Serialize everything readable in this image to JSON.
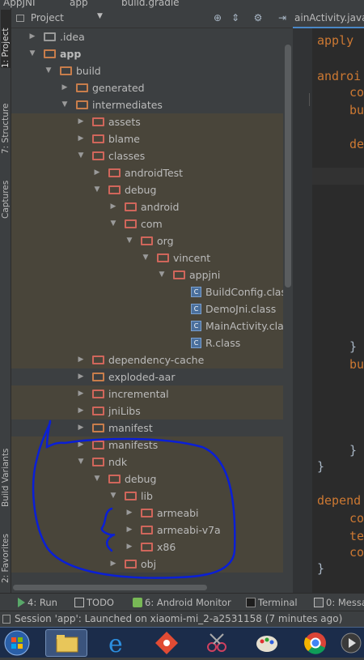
{
  "titlebar": {
    "crumbs": [
      "AppJNI",
      "app",
      "build.gradle"
    ]
  },
  "left_strip": {
    "tabs": [
      "1: Project",
      "7: Structure",
      "Captures",
      "Build Variants",
      "2: Favorites"
    ]
  },
  "project_panel": {
    "view_selector": "Project",
    "header_icons": [
      "locate-icon",
      "collapse-icon",
      "gear-icon",
      "hide-icon"
    ]
  },
  "tree": [
    {
      "label": ".idea",
      "level": 1,
      "state": "collapsed",
      "icon": "folder-grey",
      "excluded": false
    },
    {
      "label": "app",
      "level": 1,
      "state": "expanded",
      "icon": "folder-module",
      "excluded": false
    },
    {
      "label": "build",
      "level": 2,
      "state": "expanded",
      "icon": "folder",
      "excluded": false
    },
    {
      "label": "generated",
      "level": 3,
      "state": "collapsed",
      "icon": "folder",
      "excluded": false
    },
    {
      "label": "intermediates",
      "level": 3,
      "state": "expanded",
      "icon": "folder",
      "excluded": false
    },
    {
      "label": "assets",
      "level": 4,
      "state": "collapsed",
      "icon": "folder",
      "excluded": true
    },
    {
      "label": "blame",
      "level": 4,
      "state": "collapsed",
      "icon": "folder",
      "excluded": true
    },
    {
      "label": "classes",
      "level": 4,
      "state": "expanded",
      "icon": "folder",
      "excluded": true
    },
    {
      "label": "androidTest",
      "level": 5,
      "state": "collapsed",
      "icon": "folder",
      "excluded": true
    },
    {
      "label": "debug",
      "level": 5,
      "state": "expanded",
      "icon": "folder",
      "excluded": true
    },
    {
      "label": "android",
      "level": 6,
      "state": "collapsed",
      "icon": "folder",
      "excluded": true
    },
    {
      "label": "com",
      "level": 6,
      "state": "expanded",
      "icon": "folder",
      "excluded": true
    },
    {
      "label": "org",
      "level": 7,
      "state": "expanded",
      "icon": "folder",
      "excluded": true
    },
    {
      "label": "vincent",
      "level": 8,
      "state": "expanded",
      "icon": "folder",
      "excluded": true
    },
    {
      "label": "appjni",
      "level": 9,
      "state": "expanded",
      "icon": "folder",
      "excluded": true
    },
    {
      "label": "BuildConfig.class",
      "level": 10,
      "state": "leaf",
      "icon": "class",
      "excluded": true
    },
    {
      "label": "DemoJni.class",
      "level": 10,
      "state": "leaf",
      "icon": "class",
      "excluded": true
    },
    {
      "label": "MainActivity.class",
      "level": 10,
      "state": "leaf",
      "icon": "class",
      "excluded": true
    },
    {
      "label": "R.class",
      "level": 10,
      "state": "leaf",
      "icon": "class",
      "excluded": true
    },
    {
      "label": "dependency-cache",
      "level": 4,
      "state": "collapsed",
      "icon": "folder",
      "excluded": true
    },
    {
      "label": "exploded-aar",
      "level": 4,
      "state": "collapsed",
      "icon": "folder",
      "excluded": false
    },
    {
      "label": "incremental",
      "level": 4,
      "state": "collapsed",
      "icon": "folder",
      "excluded": true
    },
    {
      "label": "jniLibs",
      "level": 4,
      "state": "collapsed",
      "icon": "folder",
      "excluded": true
    },
    {
      "label": "manifest",
      "level": 4,
      "state": "collapsed",
      "icon": "folder",
      "excluded": false
    },
    {
      "label": "manifests",
      "level": 4,
      "state": "collapsed",
      "icon": "folder",
      "excluded": true
    },
    {
      "label": "ndk",
      "level": 4,
      "state": "expanded",
      "icon": "folder",
      "excluded": true
    },
    {
      "label": "debug",
      "level": 5,
      "state": "expanded",
      "icon": "folder",
      "excluded": true
    },
    {
      "label": "lib",
      "level": 6,
      "state": "expanded",
      "icon": "folder",
      "excluded": true
    },
    {
      "label": "armeabi",
      "level": 7,
      "state": "collapsed",
      "icon": "folder",
      "excluded": true
    },
    {
      "label": "armeabi-v7a",
      "level": 7,
      "state": "collapsed",
      "icon": "folder",
      "excluded": true
    },
    {
      "label": "x86",
      "level": 7,
      "state": "collapsed",
      "icon": "folder",
      "excluded": true
    },
    {
      "label": "obj",
      "level": 6,
      "state": "collapsed",
      "icon": "folder",
      "excluded": true
    }
  ],
  "editor": {
    "tab_label": "ainActivity.java",
    "lines": [
      {
        "text": "apply",
        "kind": "keyword"
      },
      {
        "text": "androi",
        "kind": "keyword"
      },
      {
        "text": "co",
        "kind": "keyword"
      },
      {
        "text": "bu",
        "kind": "keyword"
      },
      {
        "text": "de",
        "kind": "keyword"
      },
      {
        "text": "}",
        "kind": "plain"
      },
      {
        "text": "bu",
        "kind": "keyword"
      },
      {
        "text": "}",
        "kind": "plain"
      },
      {
        "text": "}",
        "kind": "plain"
      },
      {
        "text": "depend",
        "kind": "keyword"
      },
      {
        "text": "co",
        "kind": "keyword"
      },
      {
        "text": "te",
        "kind": "keyword"
      },
      {
        "text": "co",
        "kind": "keyword"
      },
      {
        "text": "}",
        "kind": "plain"
      }
    ]
  },
  "bottom_tabs": [
    {
      "label": "4: Run",
      "icon": "run-icon"
    },
    {
      "label": "TODO",
      "icon": "todo-icon"
    },
    {
      "label": "6: Android Monitor",
      "icon": "android-monitor-icon"
    },
    {
      "label": "Terminal",
      "icon": "terminal-icon"
    },
    {
      "label": "0: Messa",
      "icon": "messages-icon"
    }
  ],
  "status": {
    "text": "Session 'app': Launched on xiaomi-mi_2-a2531158 (7 minutes ago)"
  },
  "taskbar": {
    "items": [
      "start-orb",
      "file-explorer",
      "internet-explorer",
      "git-tool",
      "snipping-tool",
      "paint",
      "chrome",
      "media-player"
    ]
  },
  "colors": {
    "annotation_stroke": "#0a1fd6",
    "excluded_row": "#49453a",
    "folder": "#c87d4b",
    "keyword": "#cc7832"
  }
}
